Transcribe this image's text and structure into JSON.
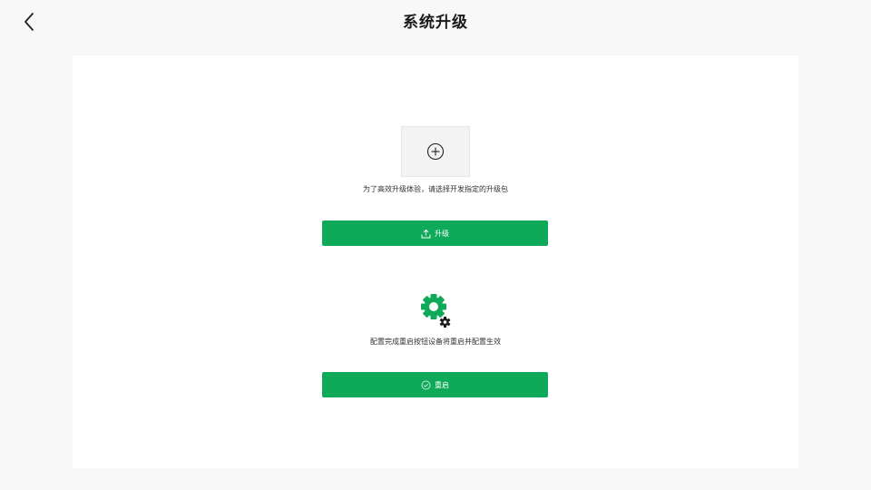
{
  "header": {
    "title": "系统升级",
    "back_icon": "chevron-left-icon"
  },
  "upload": {
    "icon": "plus-circle-icon",
    "hint": "为了高效升级体验，请选择开发指定的升级包",
    "button_label": "升级",
    "button_icon": "upload-icon"
  },
  "restart": {
    "graphic_icon": "gear-settings-icon",
    "hint": "配置完成重启按钮设备将重启并配置生效",
    "button_label": "重启",
    "button_icon": "restart-icon"
  },
  "colors": {
    "accent": "#0eaa59",
    "page_background": "#f8f8f8",
    "card_background": "#ffffff"
  }
}
